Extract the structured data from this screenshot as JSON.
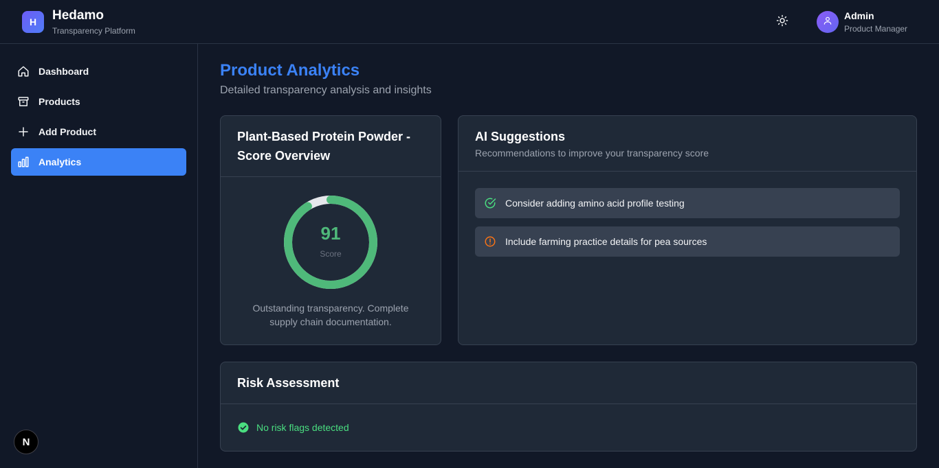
{
  "app": {
    "logo_letter": "H",
    "name": "Hedamo",
    "subtitle": "Transparency Platform"
  },
  "header": {
    "theme_icon": "sun-icon",
    "user": {
      "name": "Admin",
      "role": "Product Manager",
      "avatar_icon": "user-icon"
    }
  },
  "sidebar": {
    "items": [
      {
        "label": "Dashboard",
        "icon": "home-icon",
        "active": false
      },
      {
        "label": "Products",
        "icon": "archive-icon",
        "active": false
      },
      {
        "label": "Add Product",
        "icon": "plus-icon",
        "active": false
      },
      {
        "label": "Analytics",
        "icon": "bar-chart-icon",
        "active": true
      }
    ],
    "badge": "N"
  },
  "page": {
    "title": "Product Analytics",
    "subtitle": "Detailed transparency analysis and insights"
  },
  "score_card": {
    "title_line1": "Plant-Based Protein Powder -",
    "title_line2": "Score Overview",
    "score": 91,
    "score_max": 100,
    "score_label": "Score",
    "description_line1": "Outstanding transparency. Complete",
    "description_line2": "supply chain documentation.",
    "ring_color": "#4fb97a",
    "track_color": "#e5e7eb"
  },
  "suggestions_card": {
    "title": "AI Suggestions",
    "subtitle": "Recommendations to improve your transparency score",
    "items": [
      {
        "text": "Consider adding amino acid profile testing",
        "icon": "check-circle-icon",
        "color": "#4ade80"
      },
      {
        "text": "Include farming practice details for pea sources",
        "icon": "alert-circle-icon",
        "color": "#f97316"
      }
    ]
  },
  "risk_card": {
    "title": "Risk Assessment",
    "status": "No risk flags detected",
    "status_icon": "check-circle-filled-icon",
    "status_color": "#4ade80"
  },
  "colors": {
    "background": "#111827",
    "card": "#1f2937",
    "accent": "#3b82f6",
    "border": "#374151"
  }
}
